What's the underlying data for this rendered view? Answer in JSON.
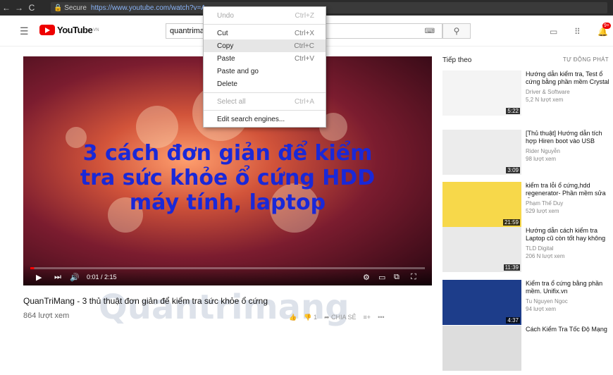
{
  "browser": {
    "secure_label": "Secure",
    "url": "https://www.youtube.com/watch?v=A",
    "back": "←",
    "forward": "→",
    "reload": "C"
  },
  "header": {
    "logo_text": "YouTube",
    "region": "VN",
    "search_value": "quantrima",
    "badge": "9+"
  },
  "context_menu": {
    "items": [
      {
        "label": "Undo",
        "shortcut": "Ctrl+Z",
        "disabled": true
      },
      {
        "label": "Cut",
        "shortcut": "Ctrl+X",
        "disabled": false
      },
      {
        "label": "Copy",
        "shortcut": "Ctrl+C",
        "disabled": false,
        "highlighted": true
      },
      {
        "label": "Paste",
        "shortcut": "Ctrl+V",
        "disabled": false
      },
      {
        "label": "Paste and go",
        "shortcut": "",
        "disabled": false
      },
      {
        "label": "Delete",
        "shortcut": "",
        "disabled": false
      },
      {
        "label": "Select all",
        "shortcut": "Ctrl+A",
        "disabled": true
      },
      {
        "label": "Edit search engines...",
        "shortcut": "",
        "disabled": false
      }
    ]
  },
  "player": {
    "overlay_title": [
      "3 cách đơn giản để kiểm",
      "tra sức khỏe ổ cứng HDD",
      "máy tính, laptop"
    ],
    "time": "0:01 / 2:15",
    "progress": 0.01
  },
  "video": {
    "title": "QuanTriMang - 3 thủ thuật đơn giản để kiểm tra sức khỏe ổ cứng",
    "views": "864 lượt xem",
    "dislikes": "1",
    "share": "CHIA SẺ"
  },
  "watermark": "Quantrimang",
  "sidebar": {
    "up_next": "Tiếp theo",
    "autoplay": "TỰ ĐỘNG PHÁT",
    "videos": [
      {
        "title": "Hướng dẫn kiểm tra, Test ổ cứng bằng phần mềm Crystal",
        "channel": "Driver & Software",
        "views": "5,2 N lượt xem",
        "duration": "5:22",
        "thumb_color": "#f4f4f4"
      },
      {
        "title": "[Thủ thuật] Hướng dẫn tích hợp Hiren boot vào USB",
        "channel": "Rider Nguyễn",
        "views": "98 lượt xem",
        "duration": "3:09",
        "thumb_color": "#ececec"
      },
      {
        "title": "kiểm tra lỗi ổ cứng,hdd regenerator- Phần mềm sửa lỗi",
        "channel": "Phạm Thế Duy",
        "views": "529 lượt xem",
        "duration": "21:59",
        "thumb_color": "#f7d84a"
      },
      {
        "title": "Hướng dẫn cách kiểm tra Laptop cũ còn tốt hay không",
        "channel": "TLD Digital",
        "views": "206 N lượt xem",
        "duration": "11:39",
        "thumb_color": "#e9e9e9"
      },
      {
        "title": "Kiểm tra ổ cứng bằng phần mềm. Unifix.vn",
        "channel": "Tu Nguyen Ngoc",
        "views": "94 lượt xem",
        "duration": "4:37",
        "thumb_color": "#1d3d8a"
      },
      {
        "title": "Cách Kiểm Tra Tốc Độ Mạng",
        "channel": "",
        "views": "",
        "duration": "",
        "thumb_color": "#ddd"
      }
    ]
  }
}
